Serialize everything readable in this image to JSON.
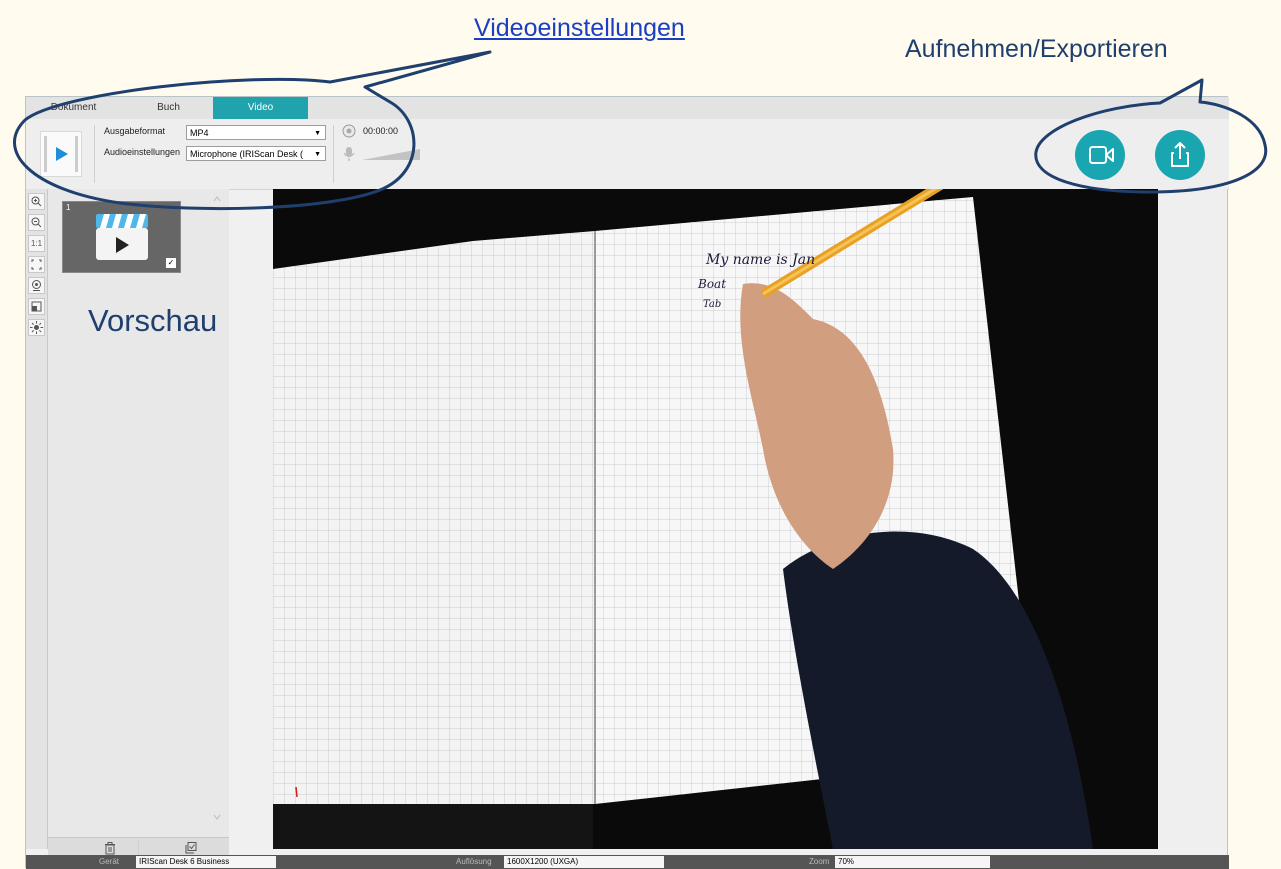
{
  "annotations": {
    "video_settings": "Videoeinstellungen",
    "record_export": "Aufnehmen/Exportieren",
    "preview": "Vorschau"
  },
  "tabs": [
    {
      "label": "Dokument",
      "active": false
    },
    {
      "label": "Buch",
      "active": false
    },
    {
      "label": "Video",
      "active": true
    }
  ],
  "video_settings": {
    "output_format_label": "Ausgabeformat",
    "output_format_value": "MP4",
    "audio_label": "Audioeinstellungen",
    "audio_value": "Microphone (IRIScan Desk (",
    "timer": "00:00:00"
  },
  "thumbnail": {
    "number": "1",
    "checked": true
  },
  "zoom_buttons": [
    "zoom-in-icon",
    "zoom-out-icon",
    "actual-size-icon",
    "fit-icon",
    "webcam-icon",
    "crop-icon",
    "brightness-icon"
  ],
  "zoom_button_labels": {
    "actual_size": "1:1"
  },
  "handwriting": {
    "line1": "My name is Jan",
    "line2": "Boat",
    "line3": "Tab"
  },
  "statusbar": {
    "device_label": "Gerät",
    "device_value": "IRIScan Desk 6 Business",
    "resolution_label": "Auflösung",
    "resolution_value": "1600X1200 (UXGA)",
    "zoom_label": "Zoom",
    "zoom_value": "70%"
  },
  "colors": {
    "accent": "#1aa6b0",
    "annotation_outline": "#1f3f6e",
    "background": "#fffbee"
  }
}
